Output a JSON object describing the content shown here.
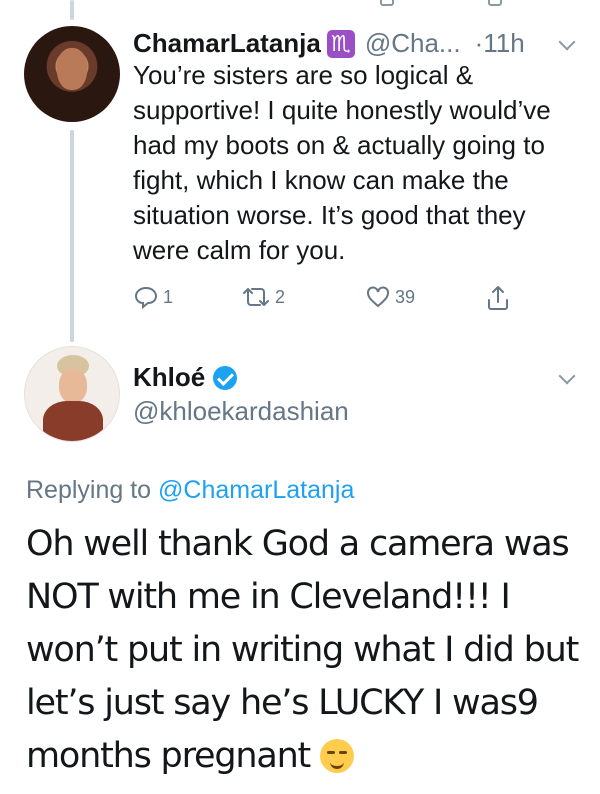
{
  "reply_tweet": {
    "display_name": "ChamarLatanja",
    "zodiac_badge": "♏",
    "handle": "@Cha...",
    "time": "·11h",
    "text": "You’re sisters are so logical & supportive! I quite honestly would’ve had my boots on & actually going to fight, which I know can make the situation worse. It’s good that they were calm for you.",
    "actions": {
      "reply_count": "1",
      "retweet_count": "2",
      "like_count": "39"
    }
  },
  "main_tweet": {
    "display_name": "Khloé",
    "handle": "@khloekardashian",
    "replying_prefix": "Replying to",
    "replying_to": "@ChamarLatanja",
    "text": "Oh well thank God a camera was NOT with me in Cleveland!!! I won’t put in writing what I did but let’s just say he’s LUCKY I was9 months pregnant",
    "emoji": "smirk-emoji"
  },
  "colors": {
    "link": "#1da1f2",
    "secondary_text": "#657786",
    "thread_line": "#ccd6dd",
    "verified": "#1da1f2",
    "zodiac_badge": "#9b4fc5"
  }
}
